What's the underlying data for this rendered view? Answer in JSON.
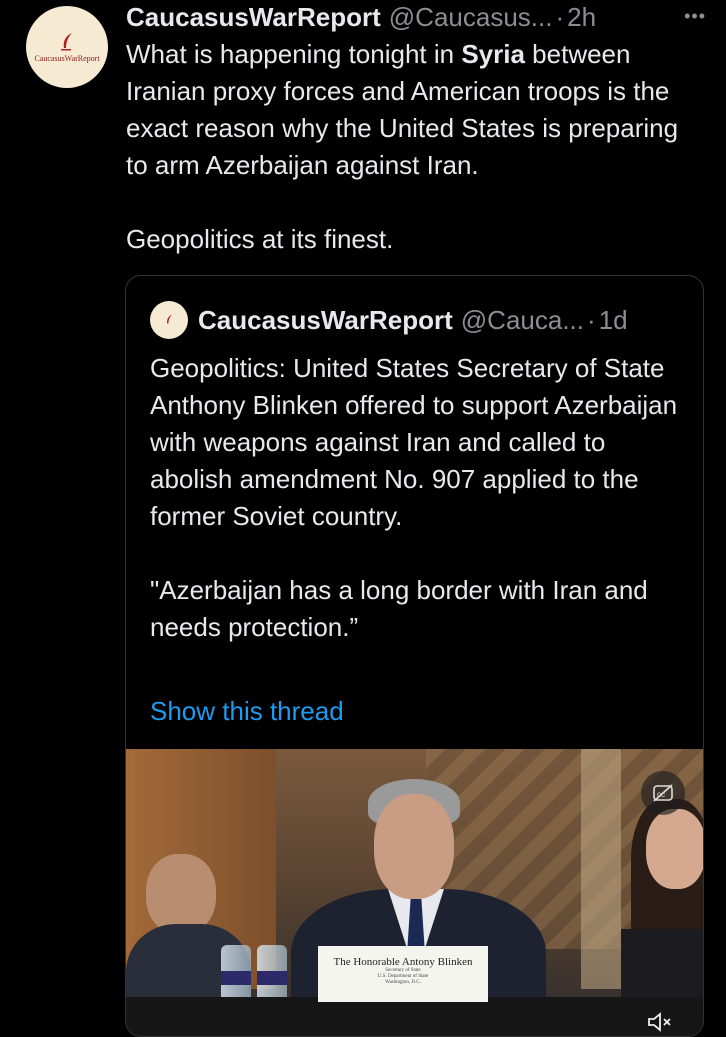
{
  "tweet": {
    "avatar_text": "CaucasusWarReport",
    "author_name": "CaucasusWarReport",
    "author_handle": "@Caucasus...",
    "separator": "·",
    "time": "2h",
    "more_label": "•••",
    "text_before": "What is happening tonight in ",
    "text_bold": "Syria",
    "text_after": " between Iranian proxy forces and American troops is the exact reason why the United States is preparing to arm Azerbaijan against Iran.\n\nGeopolitics at its finest."
  },
  "quote": {
    "author_name": "CaucasusWarReport",
    "author_handle": "@Cauca...",
    "separator": "·",
    "time": "1d",
    "text": "Geopolitics: United States Secretary of State Anthony Blinken offered to support Azerbaijan with weapons against Iran and called to abolish amendment No. 907 applied to the former Soviet country.\n\n\"Azerbaijan has a long border with Iran and needs protection.”",
    "show_thread_label": "Show this thread"
  },
  "video": {
    "nameplate_title": "The Honorable Antony Blinken",
    "nameplate_line1": "Secretary of State",
    "nameplate_line2": "U.S. Department of State",
    "nameplate_line3": "Washington, D.C.",
    "cc_icon": "closed-captions-icon",
    "mute_icon": "speaker-muted-icon"
  },
  "colors": {
    "background": "#000000",
    "text": "#e7e9ea",
    "muted": "#8b8f94",
    "link": "#1d9bf0",
    "border": "#2f3336"
  }
}
